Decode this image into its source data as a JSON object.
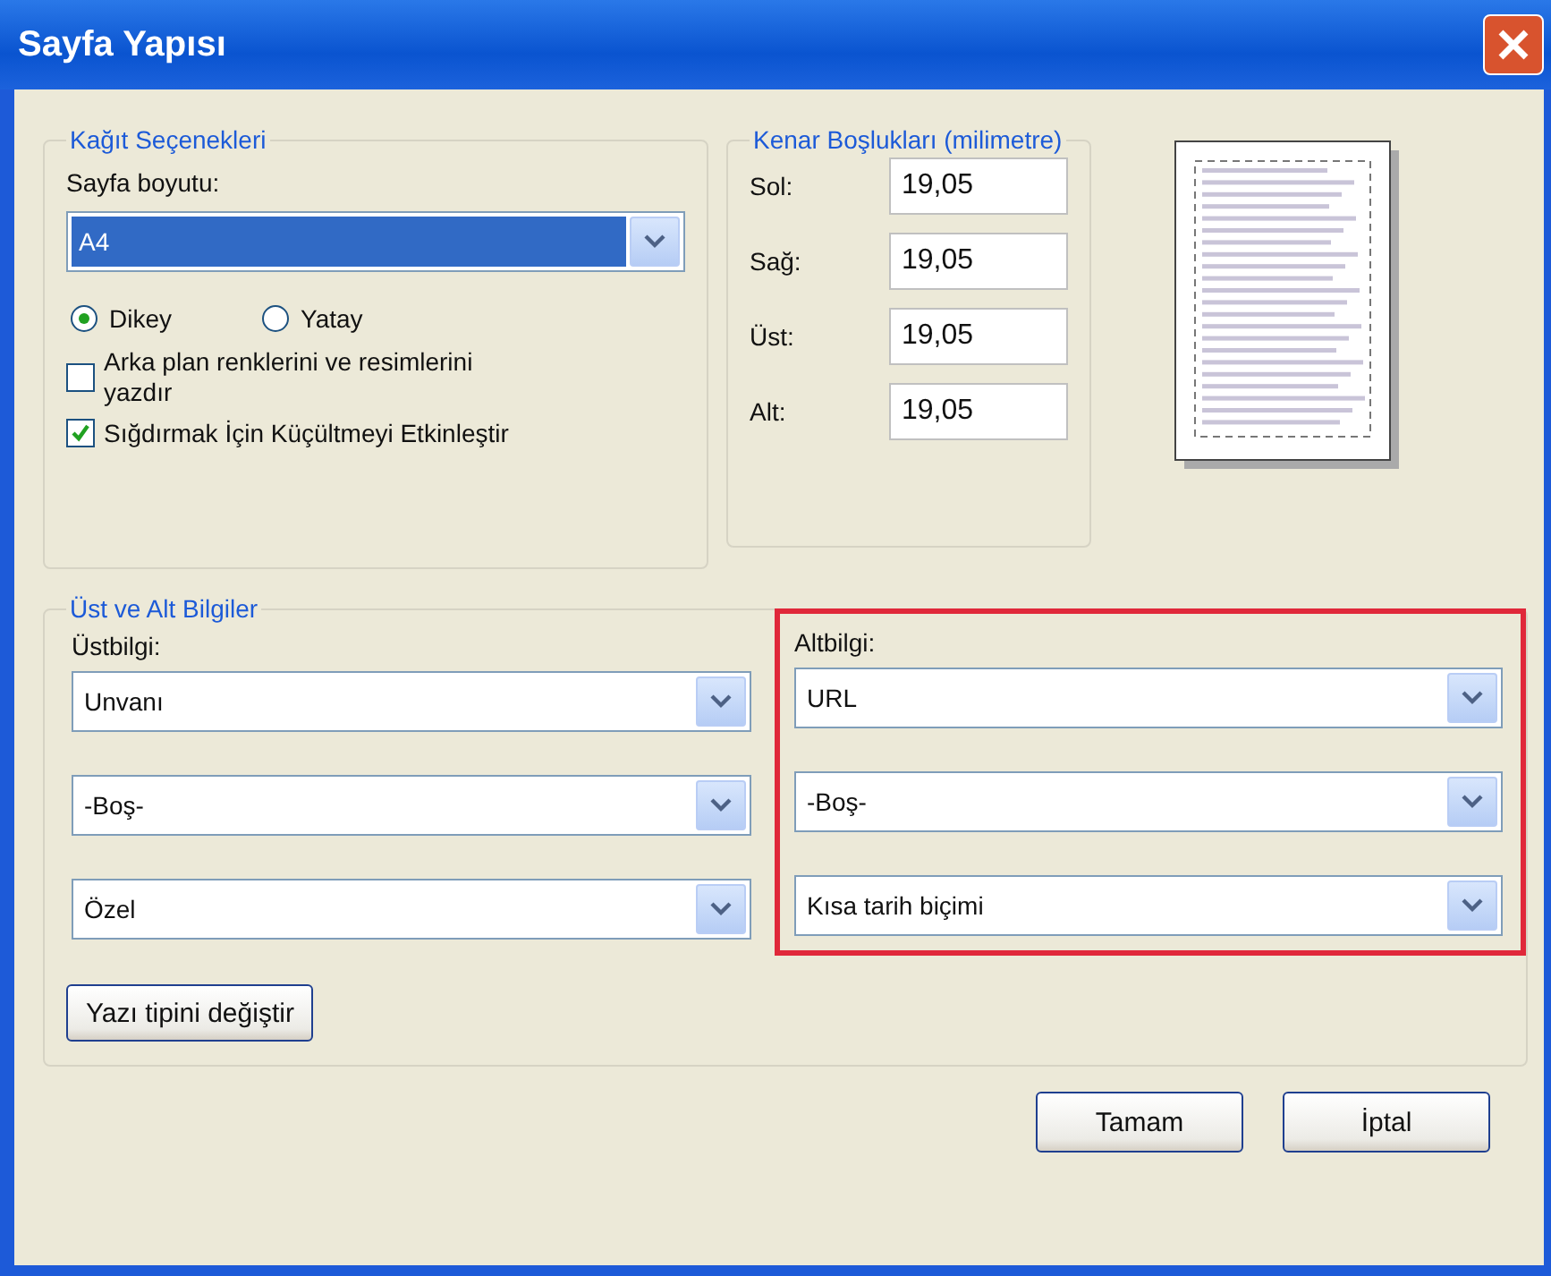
{
  "window": {
    "title": "Sayfa Yapısı"
  },
  "paper": {
    "legend": "Kağıt Seçenekleri",
    "size_label": "Sayfa boyutu:",
    "size": {
      "value": "A4",
      "selected": true
    },
    "orientation": [
      {
        "label": "Dikey",
        "selected": true
      },
      {
        "label": "Yatay",
        "selected": false
      }
    ],
    "options": [
      {
        "label": "Arka plan renklerini ve resimlerini yazdır",
        "checked": false
      },
      {
        "label": "Sığdırmak İçin Küçültmeyi Etkinleştir",
        "checked": true
      }
    ]
  },
  "margins": {
    "legend": "Kenar Boşlukları (milimetre)",
    "fields": [
      {
        "label": "Sol:",
        "value": "19,05"
      },
      {
        "label": "Sağ:",
        "value": "19,05"
      },
      {
        "label": "Üst:",
        "value": "19,05"
      },
      {
        "label": "Alt:",
        "value": "19,05"
      }
    ]
  },
  "header_footer": {
    "legend": "Üst ve Alt Bilgiler",
    "columns": [
      {
        "label": "Üstbilgi:",
        "highlighted": false,
        "selects": [
          "Unvanı",
          "-Boş-",
          "Özel"
        ]
      },
      {
        "label": "Altbilgi:",
        "highlighted": true,
        "selects": [
          "URL",
          "-Boş-",
          "Kısa tarih biçimi"
        ]
      }
    ],
    "font_button": "Yazı tipini değiştir"
  },
  "buttons": [
    "Tamam",
    "İptal"
  ]
}
